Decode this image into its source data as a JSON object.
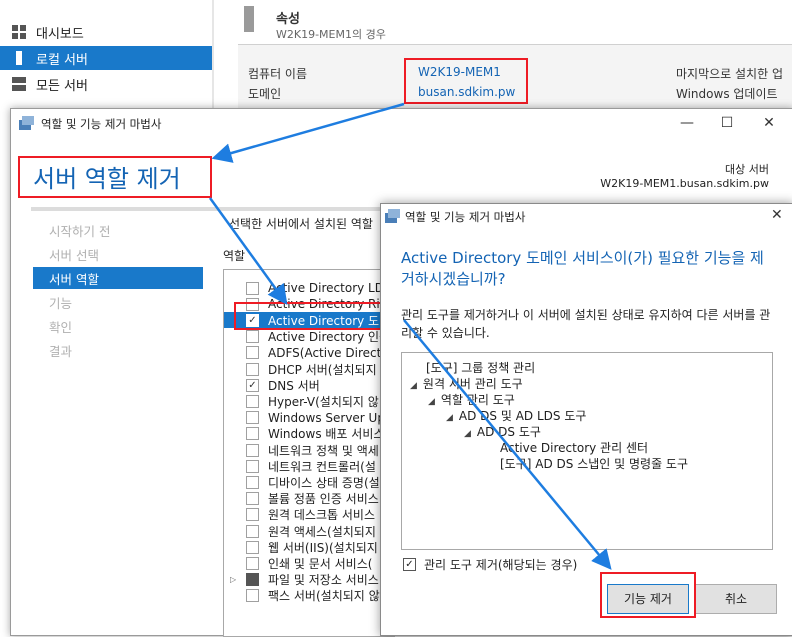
{
  "server_manager": {
    "nav": [
      {
        "label": "대시보드",
        "icon": "dashboard-icon"
      },
      {
        "label": "로컬 서버",
        "icon": "server-icon"
      },
      {
        "label": "모든 서버",
        "icon": "servers-icon"
      }
    ],
    "properties_title": "속성",
    "properties_subtitle": "W2K19-MEM1의 경우",
    "computer_name_label": "컴퓨터 이름",
    "computer_name_value": "W2K19-MEM1",
    "domain_label": "도메인",
    "domain_value": "busan.sdkim.pw",
    "last_installed_label": "마지막으로 설치한 업",
    "windows_update_label": "Windows 업데이트"
  },
  "wizard": {
    "window_title": "역할 및 기능 제거 마법사",
    "page_title": "서버 역할 제거",
    "target_label": "대상 서버",
    "target_value": "W2K19-MEM1.busan.sdkim.pw",
    "steps": [
      "시작하기 전",
      "서버 선택",
      "서버 역할",
      "기능",
      "확인",
      "결과"
    ],
    "active_step": 2,
    "description": "선택한 서버에서 설치된 역할",
    "roles_label": "역할",
    "roles": [
      {
        "label": "Active Directory LDS",
        "checked": false
      },
      {
        "label": "Active Directory Righ",
        "checked": false
      },
      {
        "label": "Active Directory 도메",
        "checked": true,
        "selected": true
      },
      {
        "label": "Active Directory 인증",
        "checked": false
      },
      {
        "label": "ADFS(Active Director",
        "checked": false
      },
      {
        "label": "DHCP 서버(설치되지",
        "checked": false
      },
      {
        "label": "DNS 서버",
        "checked": true
      },
      {
        "label": "Hyper-V(설치되지 않",
        "checked": false
      },
      {
        "label": "Windows Server Upd",
        "checked": false
      },
      {
        "label": "Windows 배포 서비스",
        "checked": false
      },
      {
        "label": "네트워크 정책 및 액세",
        "checked": false
      },
      {
        "label": "네트워크 컨트롤러(설",
        "checked": false
      },
      {
        "label": "디바이스 상태 증명(설",
        "checked": false
      },
      {
        "label": "볼륨 정품 인증 서비스",
        "checked": false
      },
      {
        "label": "원격 데스크톱 서비스",
        "checked": false
      },
      {
        "label": "원격 액세스(설치되지",
        "checked": false
      },
      {
        "label": "웹 서버(IIS)(설치되지",
        "checked": false
      },
      {
        "label": "인쇄 및 문서 서비스(",
        "checked": false
      },
      {
        "label": "파일 및 저장소 서비스",
        "checked": "partial",
        "expandable": true
      },
      {
        "label": "팩스 서버(설치되지 않",
        "checked": false
      }
    ]
  },
  "dialog": {
    "window_title": "역할 및 기능 제거 마법사",
    "heading": "Active Directory 도메인 서비스이(가) 필요한 기능을 제거하시겠습니까?",
    "body": "관리 도구를 제거하거나 이 서버에 설치된 상태로 유지하여 다른 서버를 관리할 수 있습니다.",
    "tree": [
      {
        "label": "[도구] 그룹 정책 관리",
        "level": 0,
        "expander": false
      },
      {
        "label": "원격 서버 관리 도구",
        "level": 0,
        "expander": true
      },
      {
        "label": "역할 관리 도구",
        "level": 1,
        "expander": true
      },
      {
        "label": "AD DS 및 AD LDS 도구",
        "level": 2,
        "expander": true
      },
      {
        "label": "AD DS 도구",
        "level": 3,
        "expander": true
      },
      {
        "label": "Active Directory 관리 센터",
        "level": 4,
        "expander": false
      },
      {
        "label": "[도구] AD DS 스냅인 및 명령줄 도구",
        "level": 4,
        "expander": false
      }
    ],
    "checkbox_label": "관리 도구 제거(해당되는 경우)",
    "checkbox_checked": true,
    "remove_button": "기능 제거",
    "cancel_button": "취소"
  },
  "colors": {
    "accent": "#1979ca",
    "highlight": "#ee1c25",
    "heading": "#1464b4"
  }
}
